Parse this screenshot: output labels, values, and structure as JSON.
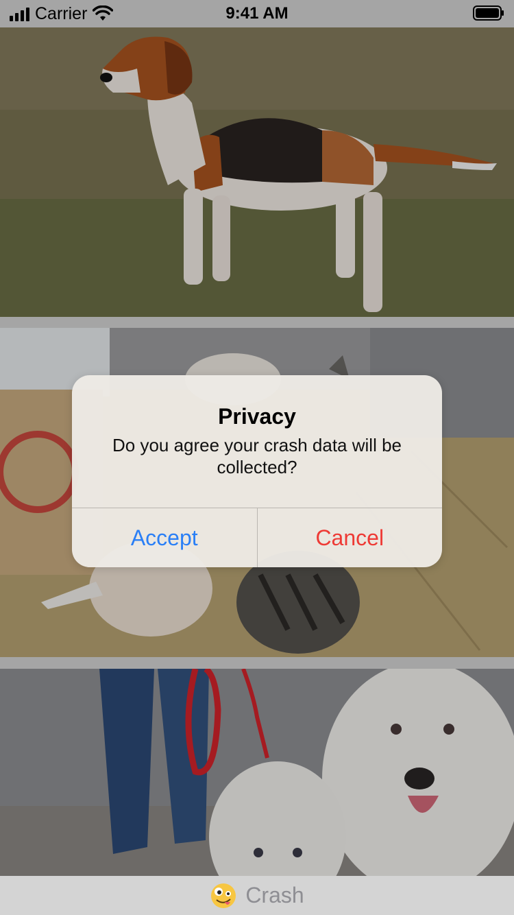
{
  "status_bar": {
    "carrier": "Carrier",
    "time": "9:41 AM",
    "icons": [
      "signal-icon",
      "wifi-icon",
      "battery-icon"
    ]
  },
  "photos": [
    {
      "name": "dog-hound-photo"
    },
    {
      "name": "dog-cat-photo"
    },
    {
      "name": "samoyed-photo"
    }
  ],
  "alert": {
    "title": "Privacy",
    "message": "Do you agree your crash data will be collected?",
    "accept_label": "Accept",
    "cancel_label": "Cancel",
    "colors": {
      "accept": "#2a7ff6",
      "cancel": "#ee3a35"
    }
  },
  "bottom_bar": {
    "icon": "zany-face-emoji-icon",
    "label": "Crash"
  }
}
